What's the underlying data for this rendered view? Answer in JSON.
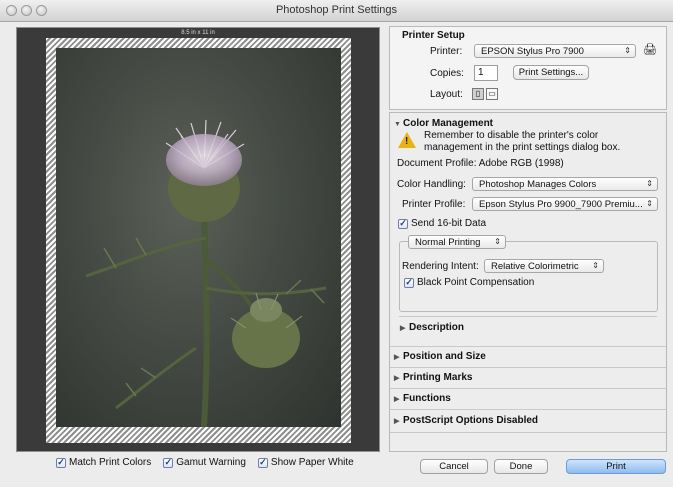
{
  "window": {
    "title": "Photoshop Print Settings"
  },
  "preview": {
    "paper_size_label": "8.5 in x 11 in"
  },
  "bottom_checks": [
    {
      "label": "Match Print Colors",
      "checked": true
    },
    {
      "label": "Gamut Warning",
      "checked": true
    },
    {
      "label": "Show Paper White",
      "checked": true
    }
  ],
  "printer_setup": {
    "header": "Printer Setup",
    "printer_label": "Printer:",
    "printer_value": "EPSON Stylus Pro 7900",
    "copies_label": "Copies:",
    "copies_value": "1",
    "print_settings_button": "Print Settings...",
    "layout_label": "Layout:"
  },
  "color_management": {
    "header": "Color Management",
    "warning_line1": "Remember to disable the printer's color",
    "warning_line2": "management in the print settings dialog box.",
    "document_profile": "Document Profile: Adobe RGB (1998)",
    "color_handling_label": "Color Handling:",
    "color_handling_value": "Photoshop Manages Colors",
    "printer_profile_label": "Printer Profile:",
    "printer_profile_value": "Epson Stylus Pro 9900_7900 Premiu...",
    "send16_label": "Send 16-bit Data",
    "send16_checked": true,
    "normal_printing_value": "Normal Printing",
    "rendering_intent_label": "Rendering Intent:",
    "rendering_intent_value": "Relative Colorimetric",
    "black_point_label": "Black Point Compensation",
    "black_point_checked": true,
    "description_label": "Description"
  },
  "sections": {
    "position_size": "Position and Size",
    "printing_marks": "Printing Marks",
    "functions": "Functions",
    "postscript": "PostScript Options Disabled"
  },
  "footer": {
    "cancel": "Cancel",
    "done": "Done",
    "print": "Print"
  },
  "colors": {
    "accent": "#8fbcf1",
    "warning": "#e7b313"
  }
}
